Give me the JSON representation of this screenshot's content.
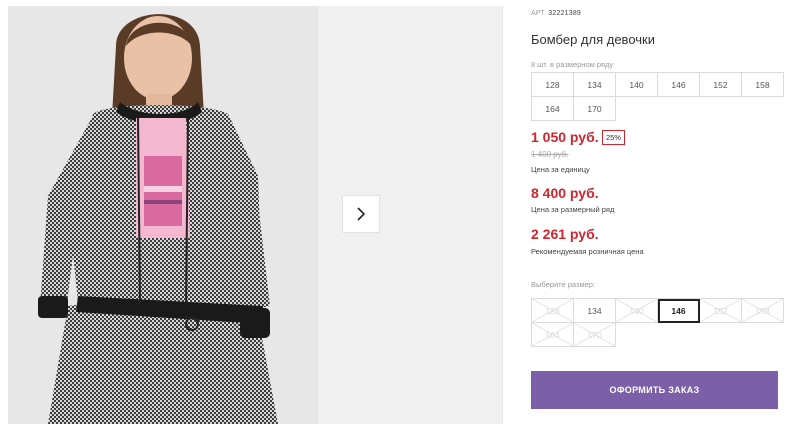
{
  "product": {
    "article_label": "АРТ.",
    "article_value": "32221389",
    "title": "Бомбер для девочки",
    "pack_label": "8 шт. в размерном ряду",
    "pack_sizes": [
      "128",
      "134",
      "140",
      "146",
      "152",
      "158",
      "164",
      "170"
    ]
  },
  "pricing": {
    "unit_price": "1 050 руб.",
    "discount_badge": "25%",
    "old_price": "1 400 руб.",
    "unit_caption": "Цена за единицу",
    "pack_price": "8 400 руб.",
    "pack_caption": "Цена за размерный ряд",
    "rrp_price": "2 261 руб.",
    "rrp_caption": "Рекомендуемая розничная цена",
    "accent_color": "#d0242f"
  },
  "size_select": {
    "label": "Выберите размер:",
    "options": [
      {
        "size": "128",
        "available": false,
        "selected": false
      },
      {
        "size": "134",
        "available": true,
        "selected": false
      },
      {
        "size": "140",
        "available": false,
        "selected": false
      },
      {
        "size": "146",
        "available": true,
        "selected": true
      },
      {
        "size": "152",
        "available": false,
        "selected": false
      },
      {
        "size": "158",
        "available": false,
        "selected": false
      },
      {
        "size": "164",
        "available": false,
        "selected": false
      },
      {
        "size": "170",
        "available": false,
        "selected": false
      }
    ]
  },
  "order_button": {
    "label": "ОФОРМИТЬ ЗАКАЗ",
    "color": "#7b5fa8"
  },
  "gallery": {
    "next_icon": "chevron-right-icon",
    "photo_description_icon": "product-photo"
  }
}
